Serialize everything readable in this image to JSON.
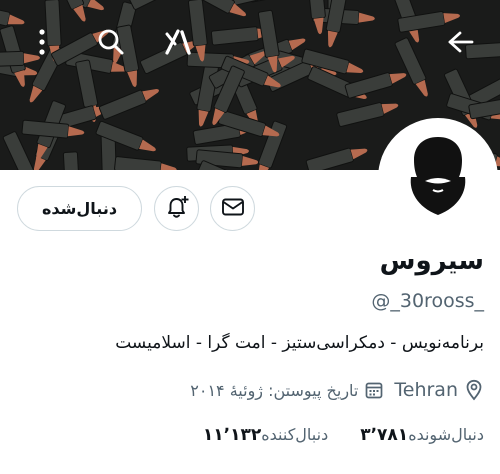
{
  "banner": {
    "background_color": "#1a1b1a",
    "bullet_case_color": "#3a3d3a",
    "bullet_tip_color": "#b56a4f"
  },
  "header": {
    "back_icon": "arrow-right-icon",
    "grok_icon": "grok-icon",
    "search_icon": "search-icon",
    "more_icon": "more-vertical-icon"
  },
  "actions": {
    "following_label": "دنبال‌شده",
    "notify_icon": "bell-plus-icon",
    "message_icon": "envelope-icon"
  },
  "profile": {
    "avatar_icon": "bearded-man-silhouette-icon",
    "display_name": "سیروس",
    "handle": "@_30rooss_",
    "bio": "برنامه‌نویس - دمکراسی‌ستیز - امت گرا - اسلامیست",
    "location": "Tehran",
    "joined": "تاریخ پیوستن: ژوئیهٔ ۲۰۱۴"
  },
  "stats": {
    "following_count": "۳٬۷۸۱",
    "following_label": "دنبال‌شونده",
    "followers_count": "۱۱٬۱۳۲",
    "followers_label": "دنبال‌کننده"
  },
  "colors": {
    "text_primary": "#0f1419",
    "text_secondary": "#536471",
    "border": "#cfd9de"
  }
}
